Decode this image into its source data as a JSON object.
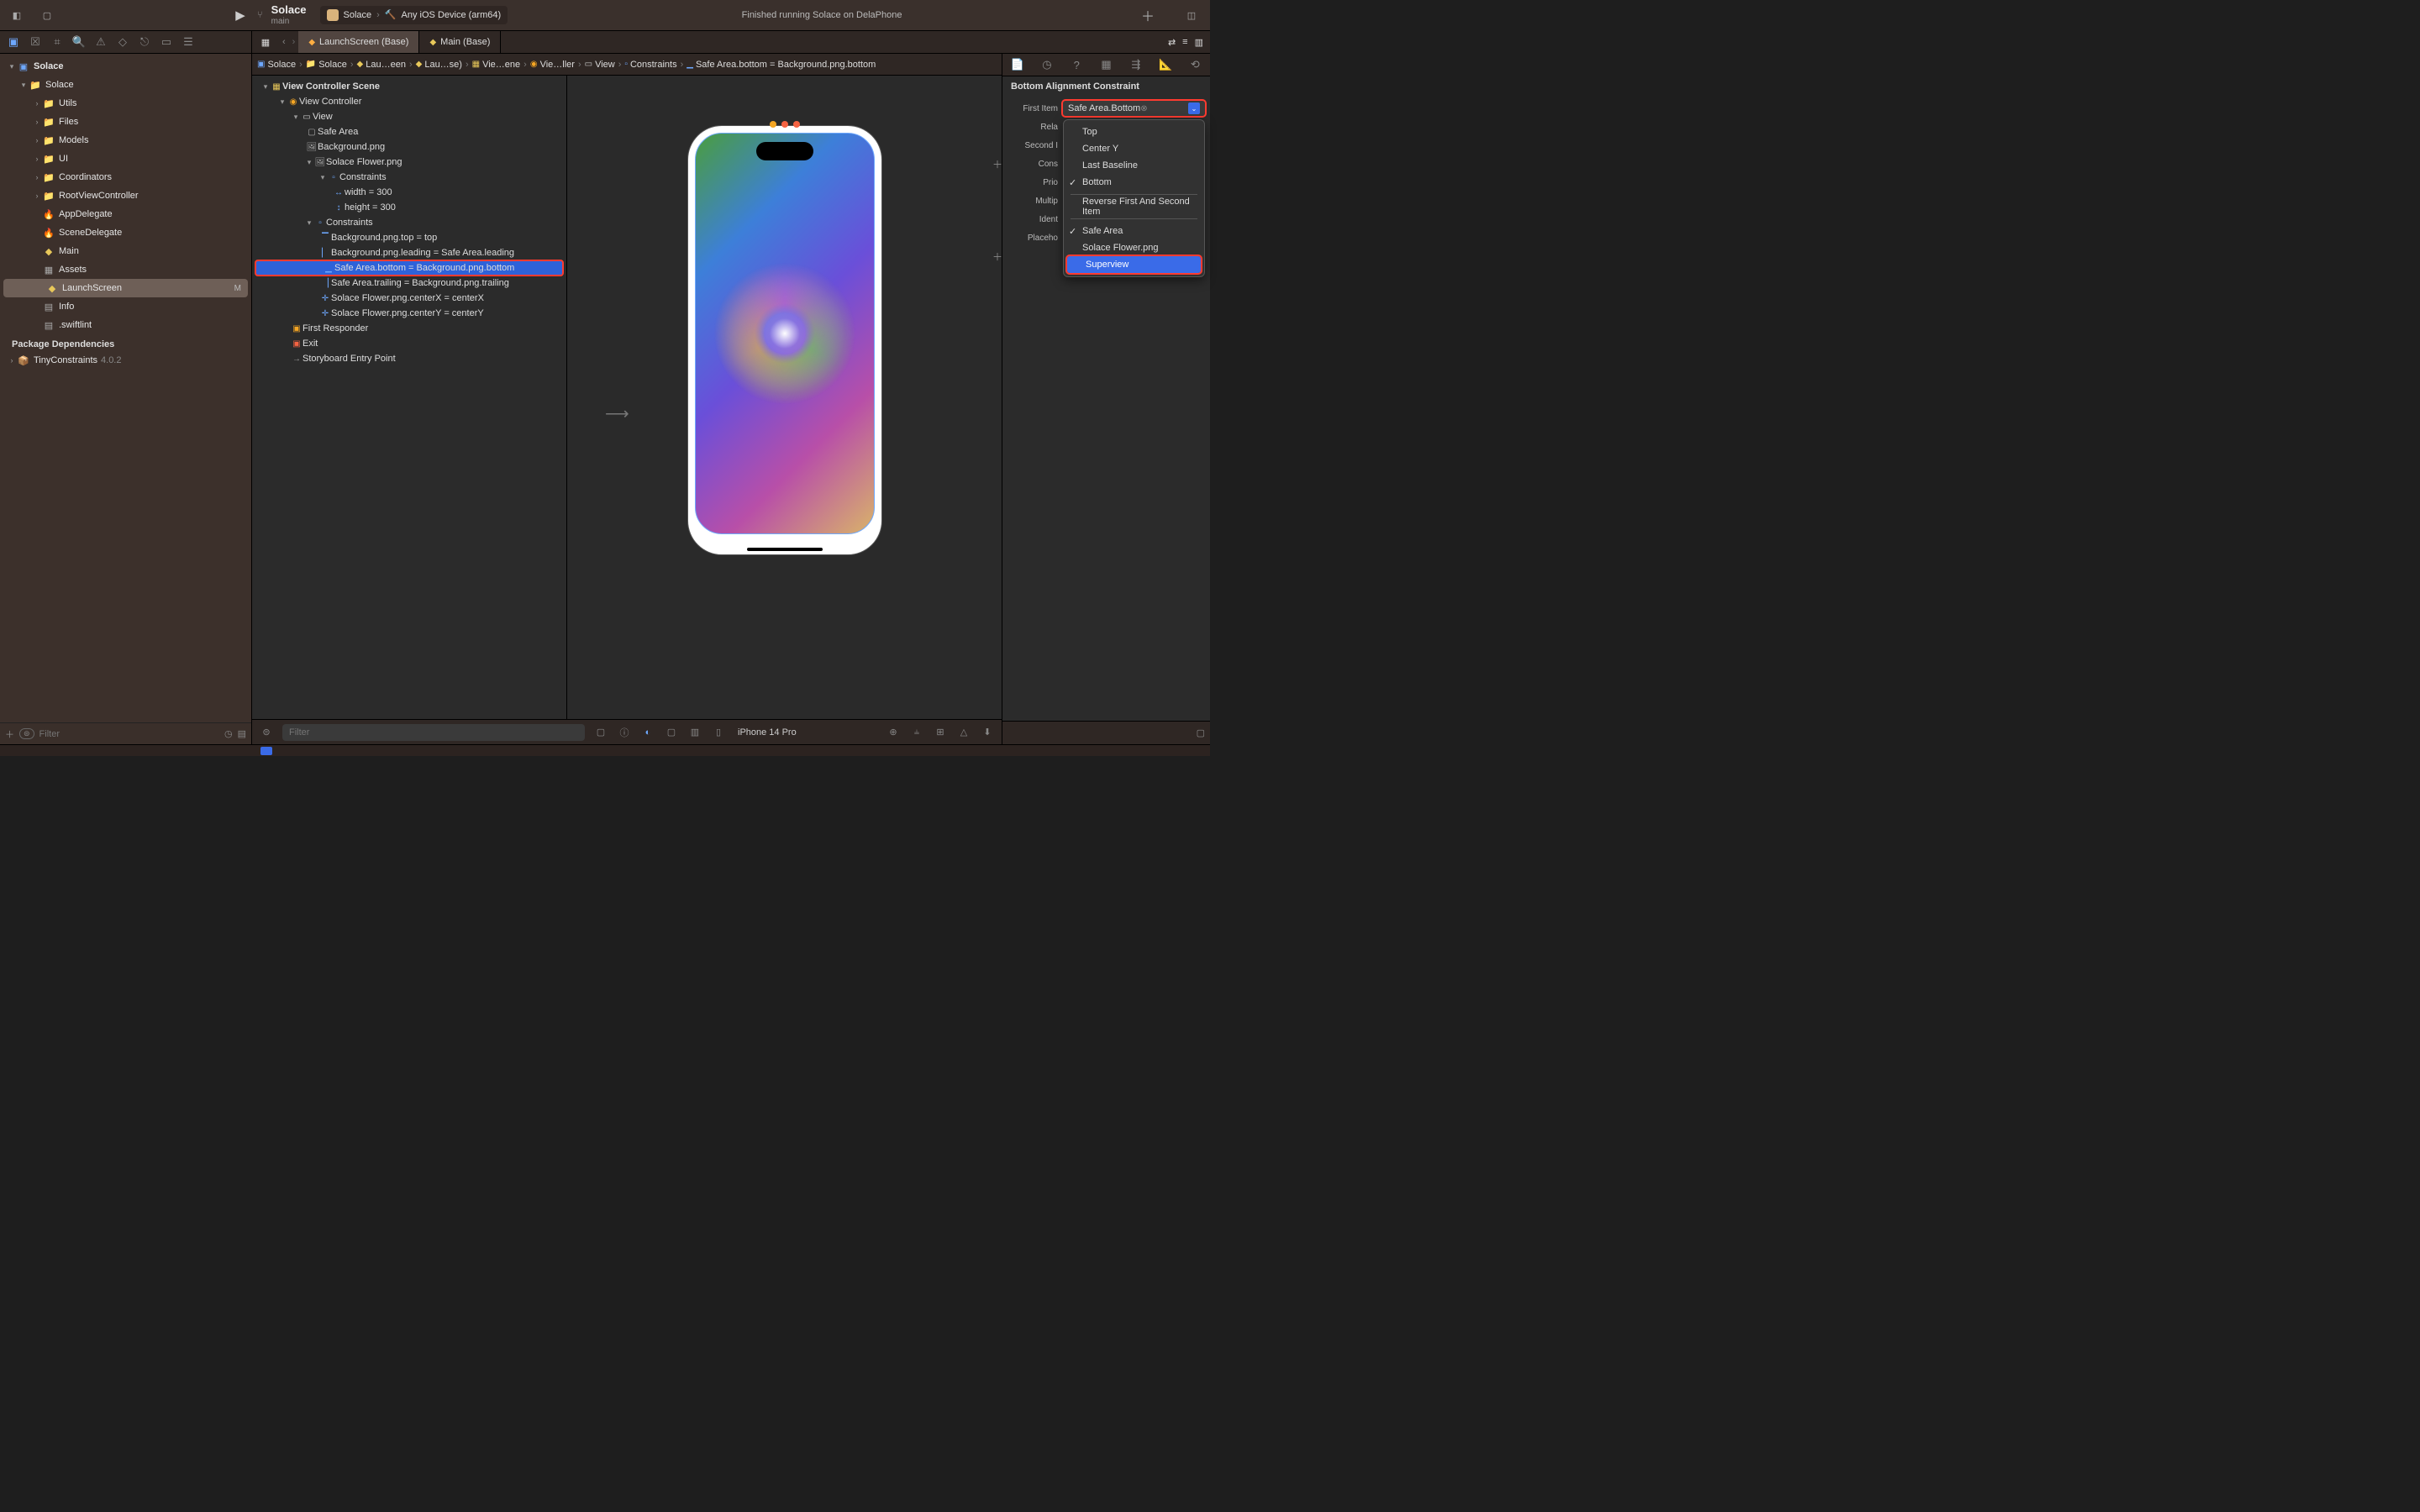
{
  "window": {
    "project": "Solace",
    "branch": "main",
    "scheme_app": "Solace",
    "scheme_dest": "Any iOS Device (arm64)",
    "status": "Finished running Solace on DelaPhone"
  },
  "tabs": [
    {
      "label": "LaunchScreen (Base)",
      "active": true
    },
    {
      "label": "Main (Base)",
      "active": false
    }
  ],
  "pathbar": [
    "Solace",
    "Solace",
    "Lau…een",
    "Lau…se)",
    "Vie…ene",
    "Vie…ller",
    "View",
    "Constraints",
    "Safe Area.bottom = Background.png.bottom"
  ],
  "navigator": {
    "root": "Solace",
    "group": "Solace",
    "folders": [
      "Utils",
      "Files",
      "Models",
      "UI",
      "Coordinators",
      "RootViewController"
    ],
    "files": [
      {
        "label": "AppDelegate",
        "kind": "swift"
      },
      {
        "label": "SceneDelegate",
        "kind": "swift"
      },
      {
        "label": "Main",
        "kind": "sb"
      },
      {
        "label": "Assets",
        "kind": "asset"
      },
      {
        "label": "LaunchScreen",
        "kind": "sb",
        "selected": true,
        "badge": "M"
      },
      {
        "label": "Info",
        "kind": "plist"
      },
      {
        "label": ".swiftlint",
        "kind": "plist"
      }
    ],
    "deps_title": "Package Dependencies",
    "deps": [
      {
        "label": "TinyConstraints",
        "ver": "4.0.2"
      }
    ],
    "filter_placeholder": "Filter"
  },
  "outline": {
    "scene": "View Controller Scene",
    "vc": "View Controller",
    "view": "View",
    "safe_area": "Safe Area",
    "bg": "Background.png",
    "flower": "Solace Flower.png",
    "flower_constraints_label": "Constraints",
    "flower_constraints": [
      "width = 300",
      "height = 300"
    ],
    "view_constraints_label": "Constraints",
    "view_constraints": [
      "Background.png.top = top",
      "Background.png.leading = Safe Area.leading",
      "Safe Area.bottom = Background.png.bottom",
      "Safe Area.trailing = Background.png.trailing",
      "Solace Flower.png.centerX = centerX",
      "Solace Flower.png.centerY = centerY"
    ],
    "selected_constraint_index": 2,
    "first_responder": "First Responder",
    "exit": "Exit",
    "entry": "Storyboard Entry Point"
  },
  "canvas": {
    "filter_placeholder": "Filter",
    "device": "iPhone 14 Pro"
  },
  "inspector": {
    "title": "Bottom Alignment Constraint",
    "rows": {
      "first_item_label": "First Item",
      "first_item_value": "Safe Area.Bottom",
      "relation_label": "Rela",
      "second_item_label": "Second I",
      "constant_label": "Cons",
      "priority_label": "Prio",
      "multiplier_label": "Multip",
      "identifier_label": "Ident",
      "placeholder_label": "Placeho"
    },
    "menu": {
      "items_a": [
        "Top",
        "Center Y",
        "Last Baseline"
      ],
      "checked_a": "Bottom",
      "reverse": "Reverse First And Second Item",
      "items_b_checked": "Safe Area",
      "items_b": [
        "Solace Flower.png"
      ],
      "hovered": "Superview"
    }
  }
}
